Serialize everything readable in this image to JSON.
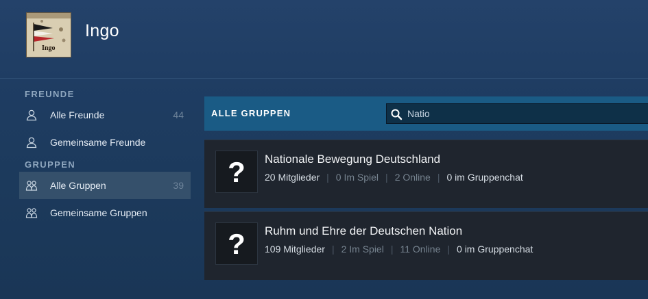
{
  "profile": {
    "username": "Ingo",
    "avatar_label": "Ingo"
  },
  "sidebar": {
    "friends_title": "FREUNDE",
    "groups_title": "GRUPPEN",
    "friends": [
      {
        "label": "Alle Freunde",
        "count": "44"
      },
      {
        "label": "Gemeinsame Freunde",
        "count": ""
      }
    ],
    "groups": [
      {
        "label": "Alle Gruppen",
        "count": "39",
        "active": true
      },
      {
        "label": "Gemeinsame Gruppen",
        "count": ""
      }
    ]
  },
  "content": {
    "title": "ALLE GRUPPEN",
    "search": {
      "value": "Natio",
      "icon": "search-icon"
    }
  },
  "groups": [
    {
      "avatar_glyph": "?",
      "name": "Nationale Bewegung Deutschland",
      "members": "20 Mitglieder",
      "in_game": "0 Im Spiel",
      "online": "2 Online",
      "in_chat": "0 im Gruppenchat"
    },
    {
      "avatar_glyph": "?",
      "name": "Ruhm und Ehre der Deutschen Nation",
      "members": "109 Mitglieder",
      "in_game": "2 Im Spiel",
      "online": "11 Online",
      "in_chat": "0 im Gruppenchat"
    }
  ],
  "colors": {
    "accent_header": "#1a5b85",
    "row_bg": "#1f252e",
    "active_nav": "#35506b"
  }
}
